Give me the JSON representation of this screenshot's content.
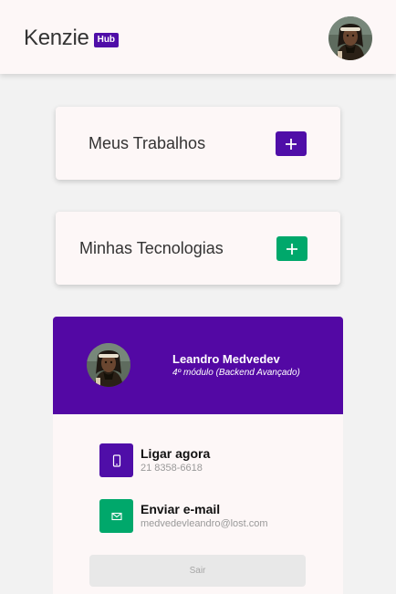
{
  "header": {
    "brand_name": "Kenzie",
    "brand_badge": "Hub"
  },
  "sections": {
    "works_title": "Meus Trabalhos",
    "techs_title": "Minhas Tecnologias"
  },
  "profile": {
    "name": "Leandro Medvedev",
    "module": "4º módulo (Backend Avançado)"
  },
  "contacts": {
    "call_title": "Ligar agora",
    "phone": "21 8358-6618",
    "email_title": "Enviar e-mail",
    "email": "medvedevleandro@lost.com"
  },
  "logout_label": "Sair",
  "colors": {
    "brand_purple": "#5308a4",
    "accent_green": "#00a86b",
    "card_bg": "#fdf7f7",
    "page_bg": "#f2f2f2"
  },
  "icons": {
    "add": "plus-icon",
    "phone": "phone-icon",
    "email": "mail-icon"
  }
}
